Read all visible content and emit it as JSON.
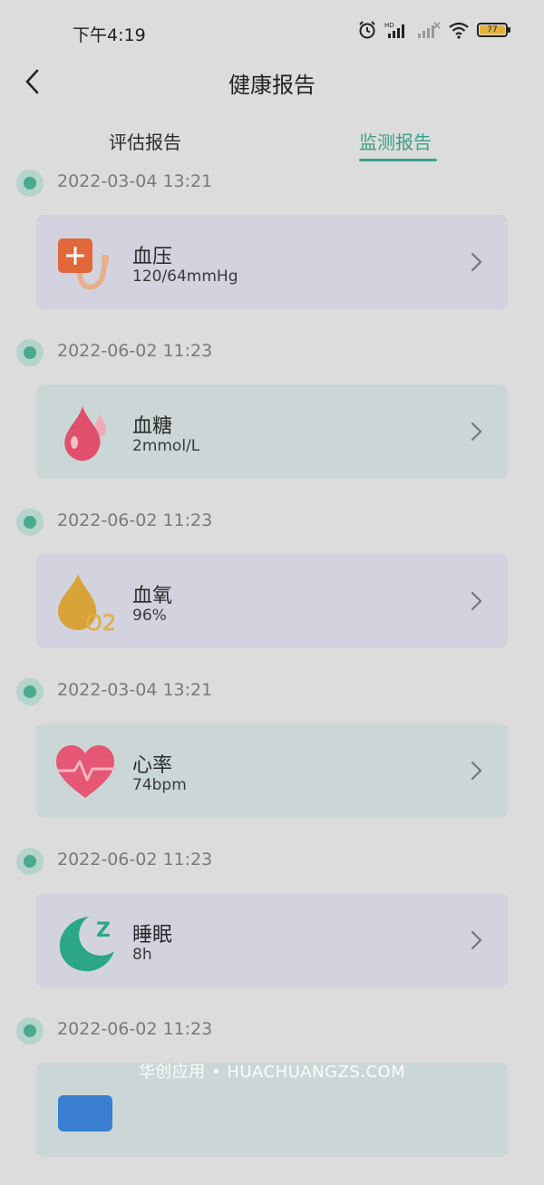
{
  "status": {
    "time": "下午4:19",
    "battery": "77"
  },
  "header": {
    "title": "健康报告"
  },
  "tabs": [
    {
      "label": "评估报告"
    },
    {
      "label": "监测报告"
    }
  ],
  "entries": [
    {
      "date": "2022-03-04 13:21",
      "name": "血压",
      "value": "120/64mmHg",
      "icon": "blood-pressure-icon"
    },
    {
      "date": "2022-06-02 11:23",
      "name": "血糖",
      "value": "2mmol/L",
      "icon": "blood-sugar-drop-icon"
    },
    {
      "date": "2022-06-02 11:23",
      "name": "血氧",
      "value": "96%",
      "icon": "oxygen-drop-icon",
      "icon_text": "O2"
    },
    {
      "date": "2022-03-04 13:21",
      "name": "心率",
      "value": "74bpm",
      "icon": "heart-rate-icon"
    },
    {
      "date": "2022-06-02 11:23",
      "name": "睡眠",
      "value": "8h",
      "icon": "sleep-moon-icon",
      "icon_text": "Z"
    },
    {
      "date": "2022-06-02 11:23"
    }
  ],
  "watermark": "华创应用 • HUACHUANGZS.COM",
  "colors": {
    "accent": "#3a9f88",
    "background": "#dcdcdc"
  }
}
